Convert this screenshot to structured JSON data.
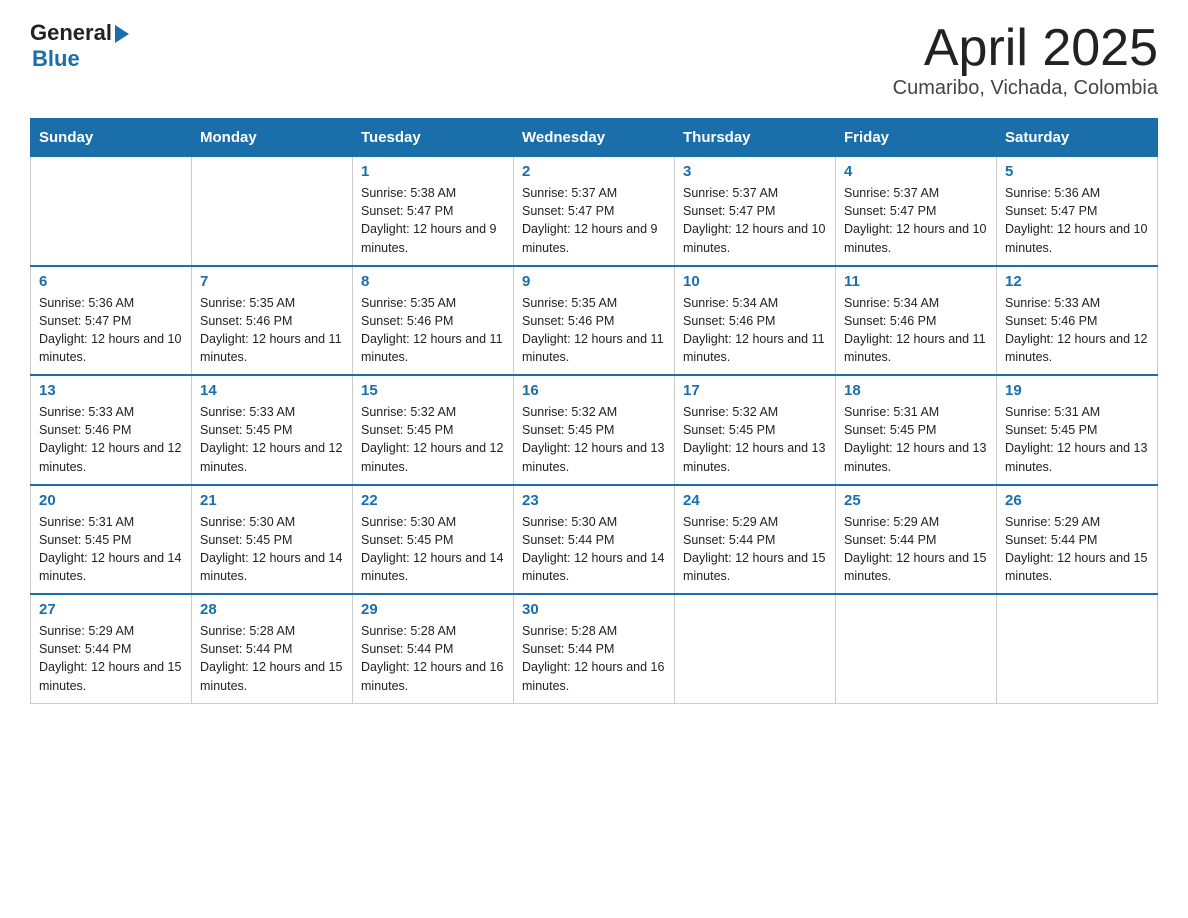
{
  "logo": {
    "general": "General",
    "blue": "Blue",
    "arrow": "▶"
  },
  "title": "April 2025",
  "subtitle": "Cumaribo, Vichada, Colombia",
  "days_of_week": [
    "Sunday",
    "Monday",
    "Tuesday",
    "Wednesday",
    "Thursday",
    "Friday",
    "Saturday"
  ],
  "weeks": [
    [
      {
        "day": "",
        "sunrise": "",
        "sunset": "",
        "daylight": ""
      },
      {
        "day": "",
        "sunrise": "",
        "sunset": "",
        "daylight": ""
      },
      {
        "day": "1",
        "sunrise": "Sunrise: 5:38 AM",
        "sunset": "Sunset: 5:47 PM",
        "daylight": "Daylight: 12 hours and 9 minutes."
      },
      {
        "day": "2",
        "sunrise": "Sunrise: 5:37 AM",
        "sunset": "Sunset: 5:47 PM",
        "daylight": "Daylight: 12 hours and 9 minutes."
      },
      {
        "day": "3",
        "sunrise": "Sunrise: 5:37 AM",
        "sunset": "Sunset: 5:47 PM",
        "daylight": "Daylight: 12 hours and 10 minutes."
      },
      {
        "day": "4",
        "sunrise": "Sunrise: 5:37 AM",
        "sunset": "Sunset: 5:47 PM",
        "daylight": "Daylight: 12 hours and 10 minutes."
      },
      {
        "day": "5",
        "sunrise": "Sunrise: 5:36 AM",
        "sunset": "Sunset: 5:47 PM",
        "daylight": "Daylight: 12 hours and 10 minutes."
      }
    ],
    [
      {
        "day": "6",
        "sunrise": "Sunrise: 5:36 AM",
        "sunset": "Sunset: 5:47 PM",
        "daylight": "Daylight: 12 hours and 10 minutes."
      },
      {
        "day": "7",
        "sunrise": "Sunrise: 5:35 AM",
        "sunset": "Sunset: 5:46 PM",
        "daylight": "Daylight: 12 hours and 11 minutes."
      },
      {
        "day": "8",
        "sunrise": "Sunrise: 5:35 AM",
        "sunset": "Sunset: 5:46 PM",
        "daylight": "Daylight: 12 hours and 11 minutes."
      },
      {
        "day": "9",
        "sunrise": "Sunrise: 5:35 AM",
        "sunset": "Sunset: 5:46 PM",
        "daylight": "Daylight: 12 hours and 11 minutes."
      },
      {
        "day": "10",
        "sunrise": "Sunrise: 5:34 AM",
        "sunset": "Sunset: 5:46 PM",
        "daylight": "Daylight: 12 hours and 11 minutes."
      },
      {
        "day": "11",
        "sunrise": "Sunrise: 5:34 AM",
        "sunset": "Sunset: 5:46 PM",
        "daylight": "Daylight: 12 hours and 11 minutes."
      },
      {
        "day": "12",
        "sunrise": "Sunrise: 5:33 AM",
        "sunset": "Sunset: 5:46 PM",
        "daylight": "Daylight: 12 hours and 12 minutes."
      }
    ],
    [
      {
        "day": "13",
        "sunrise": "Sunrise: 5:33 AM",
        "sunset": "Sunset: 5:46 PM",
        "daylight": "Daylight: 12 hours and 12 minutes."
      },
      {
        "day": "14",
        "sunrise": "Sunrise: 5:33 AM",
        "sunset": "Sunset: 5:45 PM",
        "daylight": "Daylight: 12 hours and 12 minutes."
      },
      {
        "day": "15",
        "sunrise": "Sunrise: 5:32 AM",
        "sunset": "Sunset: 5:45 PM",
        "daylight": "Daylight: 12 hours and 12 minutes."
      },
      {
        "day": "16",
        "sunrise": "Sunrise: 5:32 AM",
        "sunset": "Sunset: 5:45 PM",
        "daylight": "Daylight: 12 hours and 13 minutes."
      },
      {
        "day": "17",
        "sunrise": "Sunrise: 5:32 AM",
        "sunset": "Sunset: 5:45 PM",
        "daylight": "Daylight: 12 hours and 13 minutes."
      },
      {
        "day": "18",
        "sunrise": "Sunrise: 5:31 AM",
        "sunset": "Sunset: 5:45 PM",
        "daylight": "Daylight: 12 hours and 13 minutes."
      },
      {
        "day": "19",
        "sunrise": "Sunrise: 5:31 AM",
        "sunset": "Sunset: 5:45 PM",
        "daylight": "Daylight: 12 hours and 13 minutes."
      }
    ],
    [
      {
        "day": "20",
        "sunrise": "Sunrise: 5:31 AM",
        "sunset": "Sunset: 5:45 PM",
        "daylight": "Daylight: 12 hours and 14 minutes."
      },
      {
        "day": "21",
        "sunrise": "Sunrise: 5:30 AM",
        "sunset": "Sunset: 5:45 PM",
        "daylight": "Daylight: 12 hours and 14 minutes."
      },
      {
        "day": "22",
        "sunrise": "Sunrise: 5:30 AM",
        "sunset": "Sunset: 5:45 PM",
        "daylight": "Daylight: 12 hours and 14 minutes."
      },
      {
        "day": "23",
        "sunrise": "Sunrise: 5:30 AM",
        "sunset": "Sunset: 5:44 PM",
        "daylight": "Daylight: 12 hours and 14 minutes."
      },
      {
        "day": "24",
        "sunrise": "Sunrise: 5:29 AM",
        "sunset": "Sunset: 5:44 PM",
        "daylight": "Daylight: 12 hours and 15 minutes."
      },
      {
        "day": "25",
        "sunrise": "Sunrise: 5:29 AM",
        "sunset": "Sunset: 5:44 PM",
        "daylight": "Daylight: 12 hours and 15 minutes."
      },
      {
        "day": "26",
        "sunrise": "Sunrise: 5:29 AM",
        "sunset": "Sunset: 5:44 PM",
        "daylight": "Daylight: 12 hours and 15 minutes."
      }
    ],
    [
      {
        "day": "27",
        "sunrise": "Sunrise: 5:29 AM",
        "sunset": "Sunset: 5:44 PM",
        "daylight": "Daylight: 12 hours and 15 minutes."
      },
      {
        "day": "28",
        "sunrise": "Sunrise: 5:28 AM",
        "sunset": "Sunset: 5:44 PM",
        "daylight": "Daylight: 12 hours and 15 minutes."
      },
      {
        "day": "29",
        "sunrise": "Sunrise: 5:28 AM",
        "sunset": "Sunset: 5:44 PM",
        "daylight": "Daylight: 12 hours and 16 minutes."
      },
      {
        "day": "30",
        "sunrise": "Sunrise: 5:28 AM",
        "sunset": "Sunset: 5:44 PM",
        "daylight": "Daylight: 12 hours and 16 minutes."
      },
      {
        "day": "",
        "sunrise": "",
        "sunset": "",
        "daylight": ""
      },
      {
        "day": "",
        "sunrise": "",
        "sunset": "",
        "daylight": ""
      },
      {
        "day": "",
        "sunrise": "",
        "sunset": "",
        "daylight": ""
      }
    ]
  ]
}
